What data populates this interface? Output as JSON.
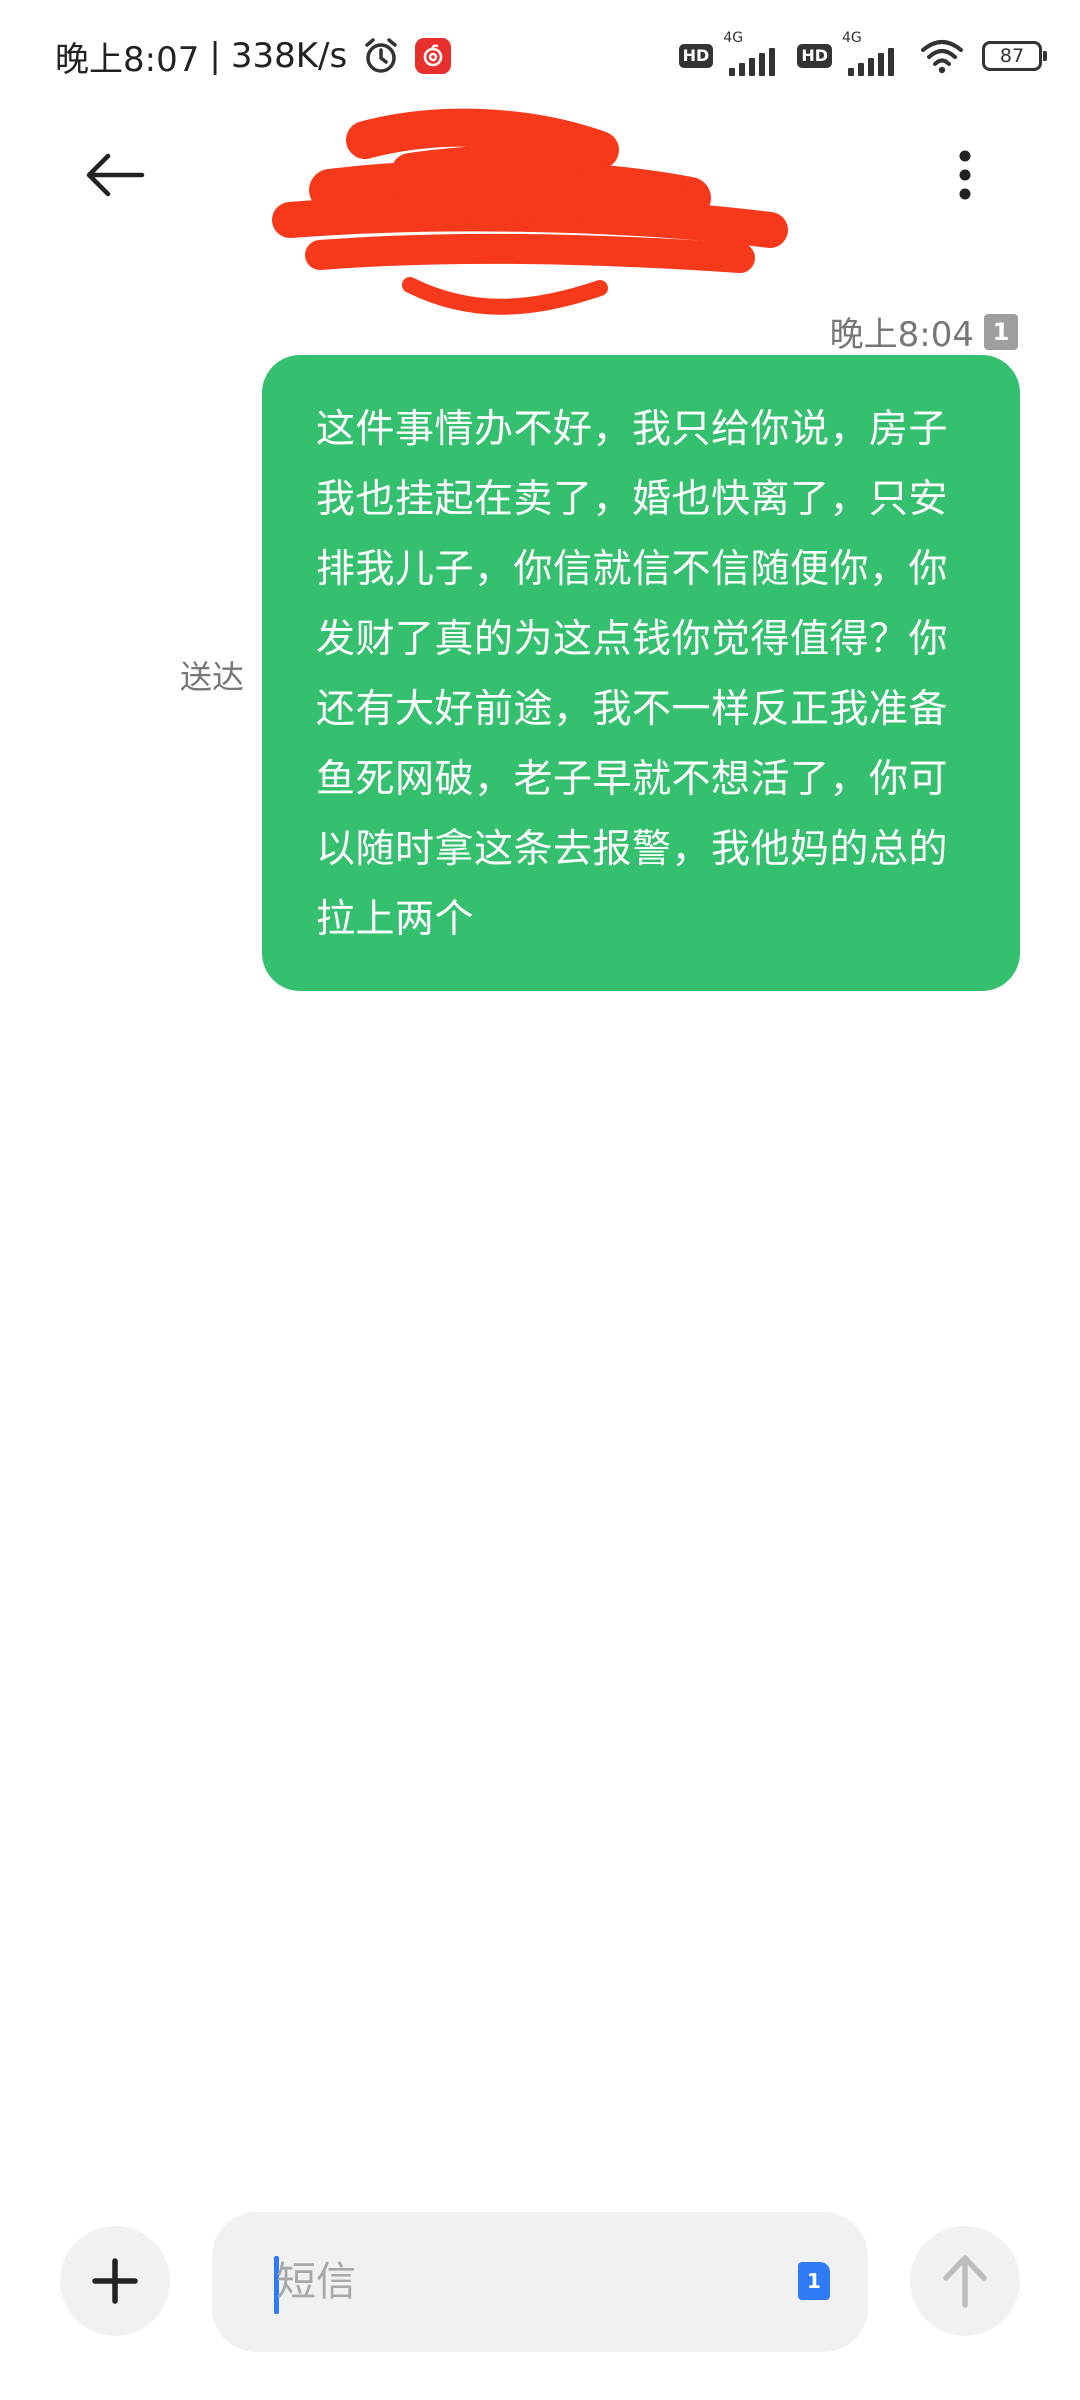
{
  "status_bar": {
    "time": "晚上8:07",
    "separator": "|",
    "net_speed": "338K/s",
    "sim1_badge": "HD",
    "sim1_network": "4G",
    "sim2_badge": "HD",
    "sim2_network": "4G",
    "battery_level": "87",
    "icons": [
      "alarm-icon",
      "netease-music-icon",
      "signal-icon",
      "wifi-icon",
      "battery-icon"
    ]
  },
  "header": {
    "contact_name": "",
    "icons": [
      "back-arrow-icon",
      "more-vertical-icon"
    ]
  },
  "conversation": {
    "message": {
      "time": "晚上8:04",
      "sim_slot": "1",
      "status": "送达",
      "text": "这件事情办不好，我只给你说，房子我也挂起在卖了，婚也快离了，只安排我儿子，你信就信不信随便你，你发财了真的为这点钱你觉得值得？你还有大好前途，我不一样反正我准备鱼死网破，老子早就不想活了，你可以随时拿这条去报警，我他妈的总的拉上两个"
    }
  },
  "composer": {
    "placeholder": "短信",
    "value": "",
    "sim_slot": "1",
    "icons": [
      "plus-icon",
      "send-arrow-icon"
    ]
  },
  "colors": {
    "bubble": "#34c06e",
    "accent": "#2f7bf5",
    "redaction": "#f5391a",
    "composer_bg": "#f1f1f1"
  }
}
